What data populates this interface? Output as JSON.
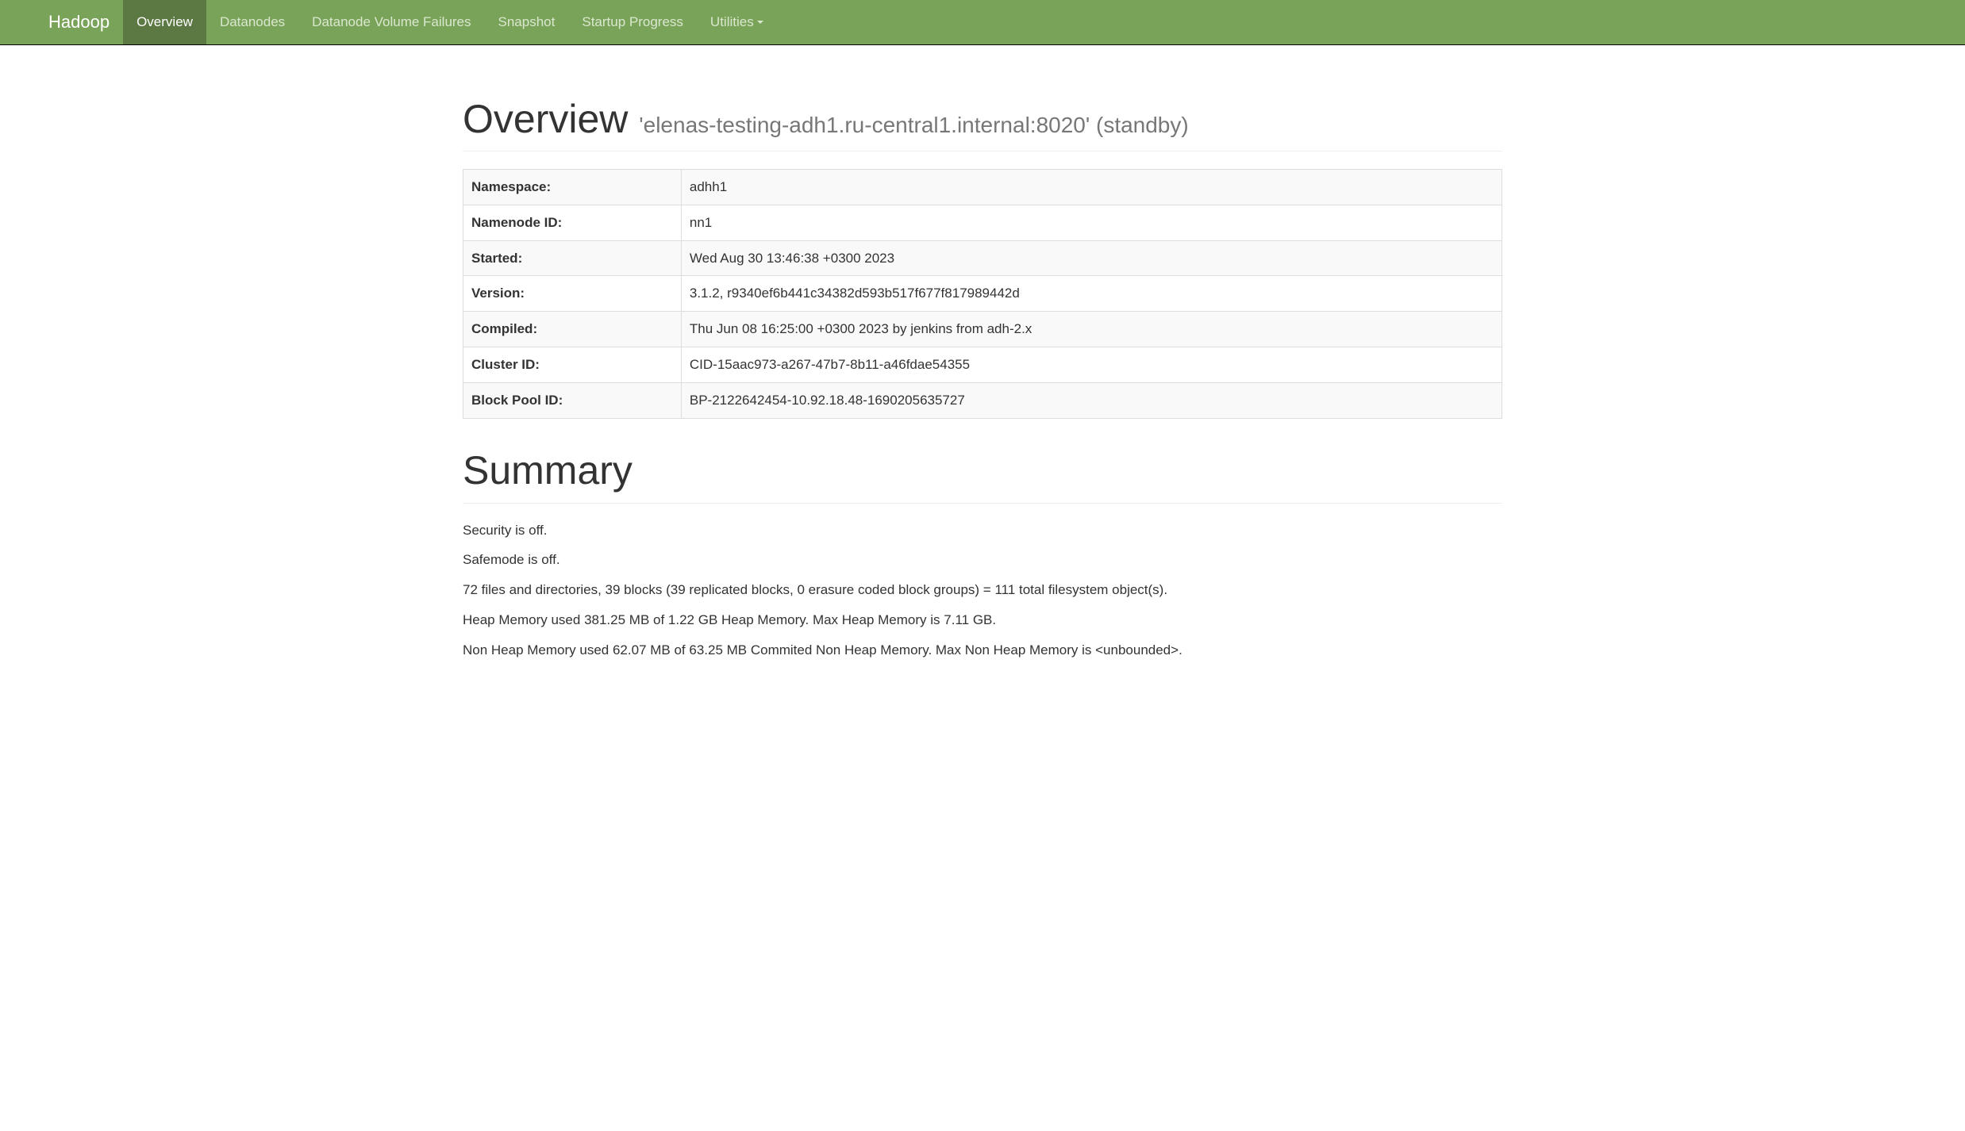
{
  "navbar": {
    "brand": "Hadoop",
    "items": [
      {
        "label": "Overview",
        "active": true
      },
      {
        "label": "Datanodes",
        "active": false
      },
      {
        "label": "Datanode Volume Failures",
        "active": false
      },
      {
        "label": "Snapshot",
        "active": false
      },
      {
        "label": "Startup Progress",
        "active": false
      },
      {
        "label": "Utilities",
        "active": false,
        "dropdown": true
      }
    ]
  },
  "overview": {
    "title": "Overview",
    "subtitle": "'elenas-testing-adh1.ru-central1.internal:8020' (standby)",
    "rows": [
      {
        "label": "Namespace:",
        "value": "adhh1"
      },
      {
        "label": "Namenode ID:",
        "value": "nn1"
      },
      {
        "label": "Started:",
        "value": "Wed Aug 30 13:46:38 +0300 2023"
      },
      {
        "label": "Version:",
        "value": "3.1.2, r9340ef6b441c34382d593b517f677f817989442d"
      },
      {
        "label": "Compiled:",
        "value": "Thu Jun 08 16:25:00 +0300 2023 by jenkins from adh-2.x"
      },
      {
        "label": "Cluster ID:",
        "value": "CID-15aac973-a267-47b7-8b11-a46fdae54355"
      },
      {
        "label": "Block Pool ID:",
        "value": "BP-2122642454-10.92.18.48-1690205635727"
      }
    ]
  },
  "summary": {
    "title": "Summary",
    "lines": [
      "Security is off.",
      "Safemode is off.",
      "72 files and directories, 39 blocks (39 replicated blocks, 0 erasure coded block groups) = 111 total filesystem object(s).",
      "Heap Memory used 381.25 MB of 1.22 GB Heap Memory. Max Heap Memory is 7.11 GB.",
      "Non Heap Memory used 62.07 MB of 63.25 MB Commited Non Heap Memory. Max Non Heap Memory is <unbounded>."
    ]
  }
}
